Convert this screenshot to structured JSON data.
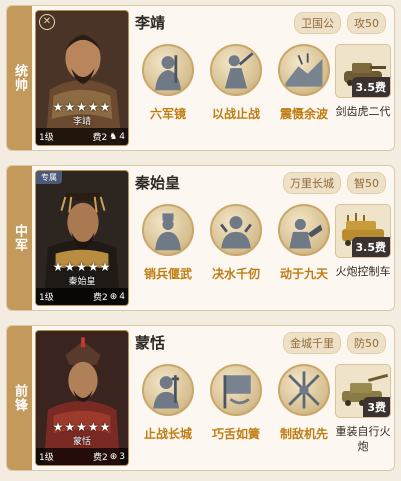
{
  "cards": [
    {
      "role": "统帅",
      "name": "李靖",
      "portrait_name": "李靖",
      "stars": "★★★★★",
      "level": "1级",
      "cost": "费2",
      "count": "4",
      "badges": [
        "卫国公",
        "攻50"
      ],
      "skills": [
        "六军镜",
        "以战止战",
        "震慑余波"
      ],
      "gear": {
        "cost": "3.5费",
        "label": "剑齿虎二代"
      }
    },
    {
      "role": "中军",
      "corner_tag": "专属",
      "name": "秦始皇",
      "portrait_name": "秦始皇",
      "stars": "★★★★★",
      "level": "1级",
      "cost": "费2",
      "count": "4",
      "badges": [
        "万里长城",
        "智50"
      ],
      "skills": [
        "销兵偃武",
        "决水千仞",
        "动于九天"
      ],
      "gear": {
        "cost": "3.5费",
        "label": "火炮控制车"
      }
    },
    {
      "role": "前锋",
      "name": "蒙恬",
      "portrait_name": "蒙恬",
      "stars": "★★★★★",
      "level": "1级",
      "cost": "费2",
      "count": "3",
      "badges": [
        "金城千里",
        "防50"
      ],
      "skills": [
        "止战长城",
        "巧舌如簧",
        "制敌机先"
      ],
      "gear": {
        "cost": "3费",
        "label": "重装自行火炮"
      }
    }
  ]
}
